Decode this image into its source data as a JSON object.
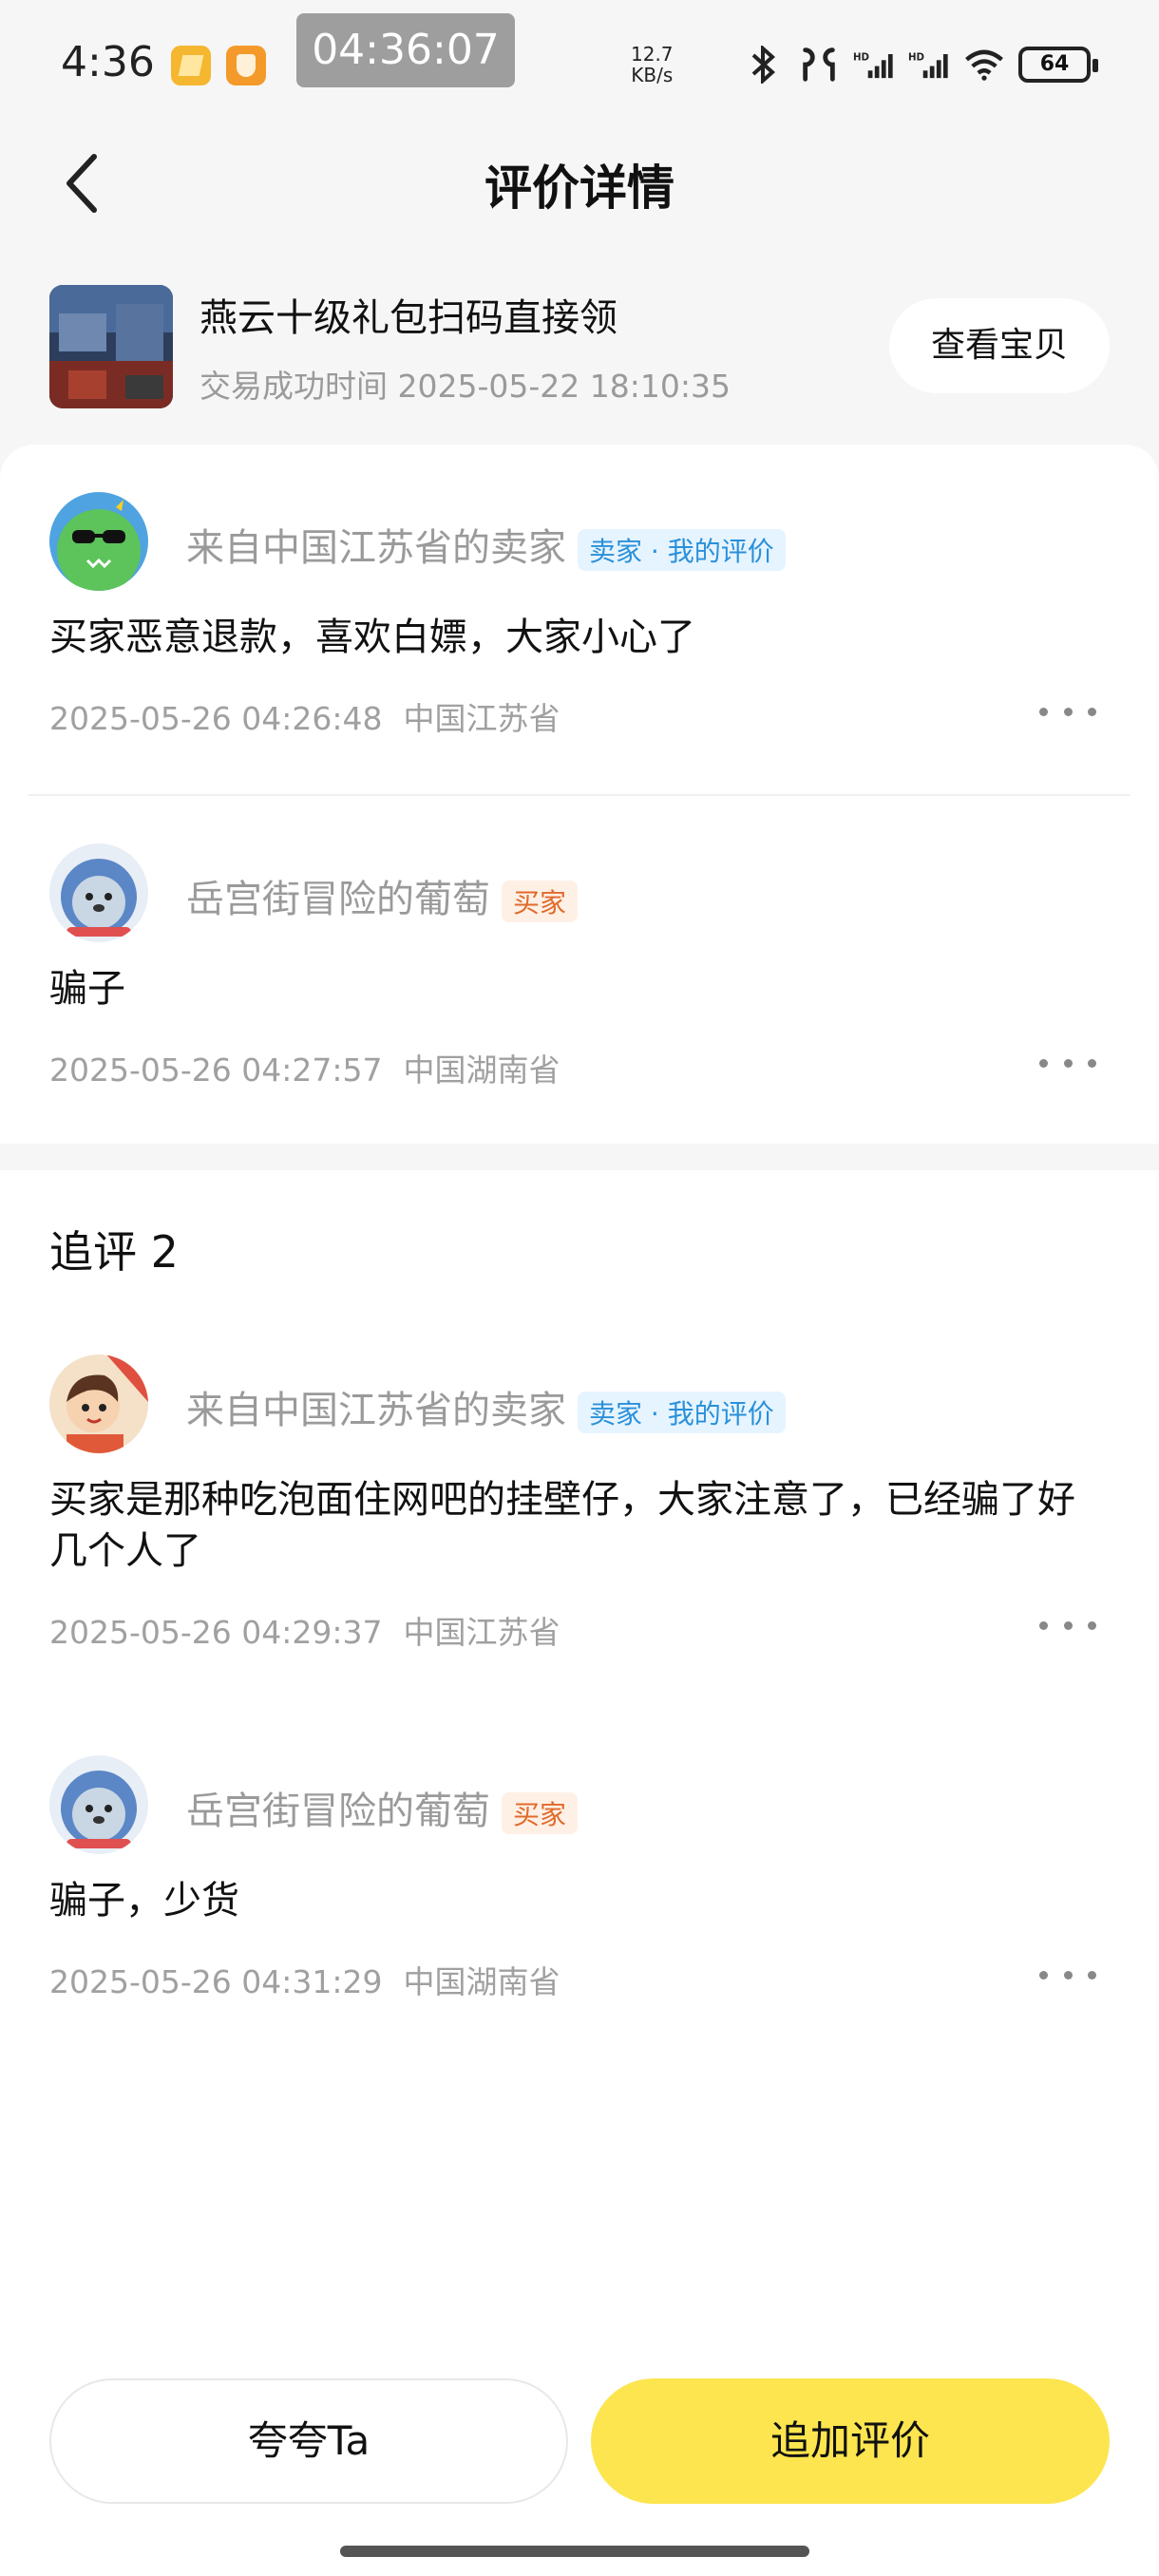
{
  "status_bar": {
    "time": "4:36",
    "clock_overlay": "04:36:07",
    "net_speed_value": "12.7",
    "net_speed_unit": "KB/s",
    "battery": "64"
  },
  "header": {
    "title": "评价详情"
  },
  "product": {
    "name": "燕云十级礼包扫码直接领",
    "deal_time": "交易成功时间 2025-05-22 18:10:35",
    "view_button": "查看宝贝"
  },
  "reviews": [
    {
      "name": "来自中国江苏省的卖家",
      "badge": "卖家 · 我的评价",
      "role": "seller",
      "text": "买家恶意退款，喜欢白嫖，大家小心了",
      "date": "2025-05-26 04:26:48",
      "location": "中国江苏省"
    },
    {
      "name": "岳宫街冒险的葡萄",
      "badge": "买家",
      "role": "buyer",
      "text": "骗子",
      "date": "2025-05-26 04:27:57",
      "location": "中国湖南省"
    }
  ],
  "followup": {
    "title": "追评 2",
    "items": [
      {
        "name": "来自中国江苏省的卖家",
        "badge": "卖家 · 我的评价",
        "role": "seller",
        "text": "买家是那种吃泡面住网吧的挂壁仔，大家注意了，已经骗了好几个人了",
        "date": "2025-05-26 04:29:37",
        "location": "中国江苏省"
      },
      {
        "name": "岳宫街冒险的葡萄",
        "badge": "买家",
        "role": "buyer",
        "text": "骗子，少货",
        "date": "2025-05-26 04:31:29",
        "location": "中国湖南省"
      }
    ]
  },
  "bottom": {
    "praise_button": "夸夸Ta",
    "add_review_button": "追加评价"
  },
  "colors": {
    "accent_yellow": "#fde54f",
    "seller_badge": "#2a90d9",
    "buyer_badge": "#e06a2a"
  }
}
